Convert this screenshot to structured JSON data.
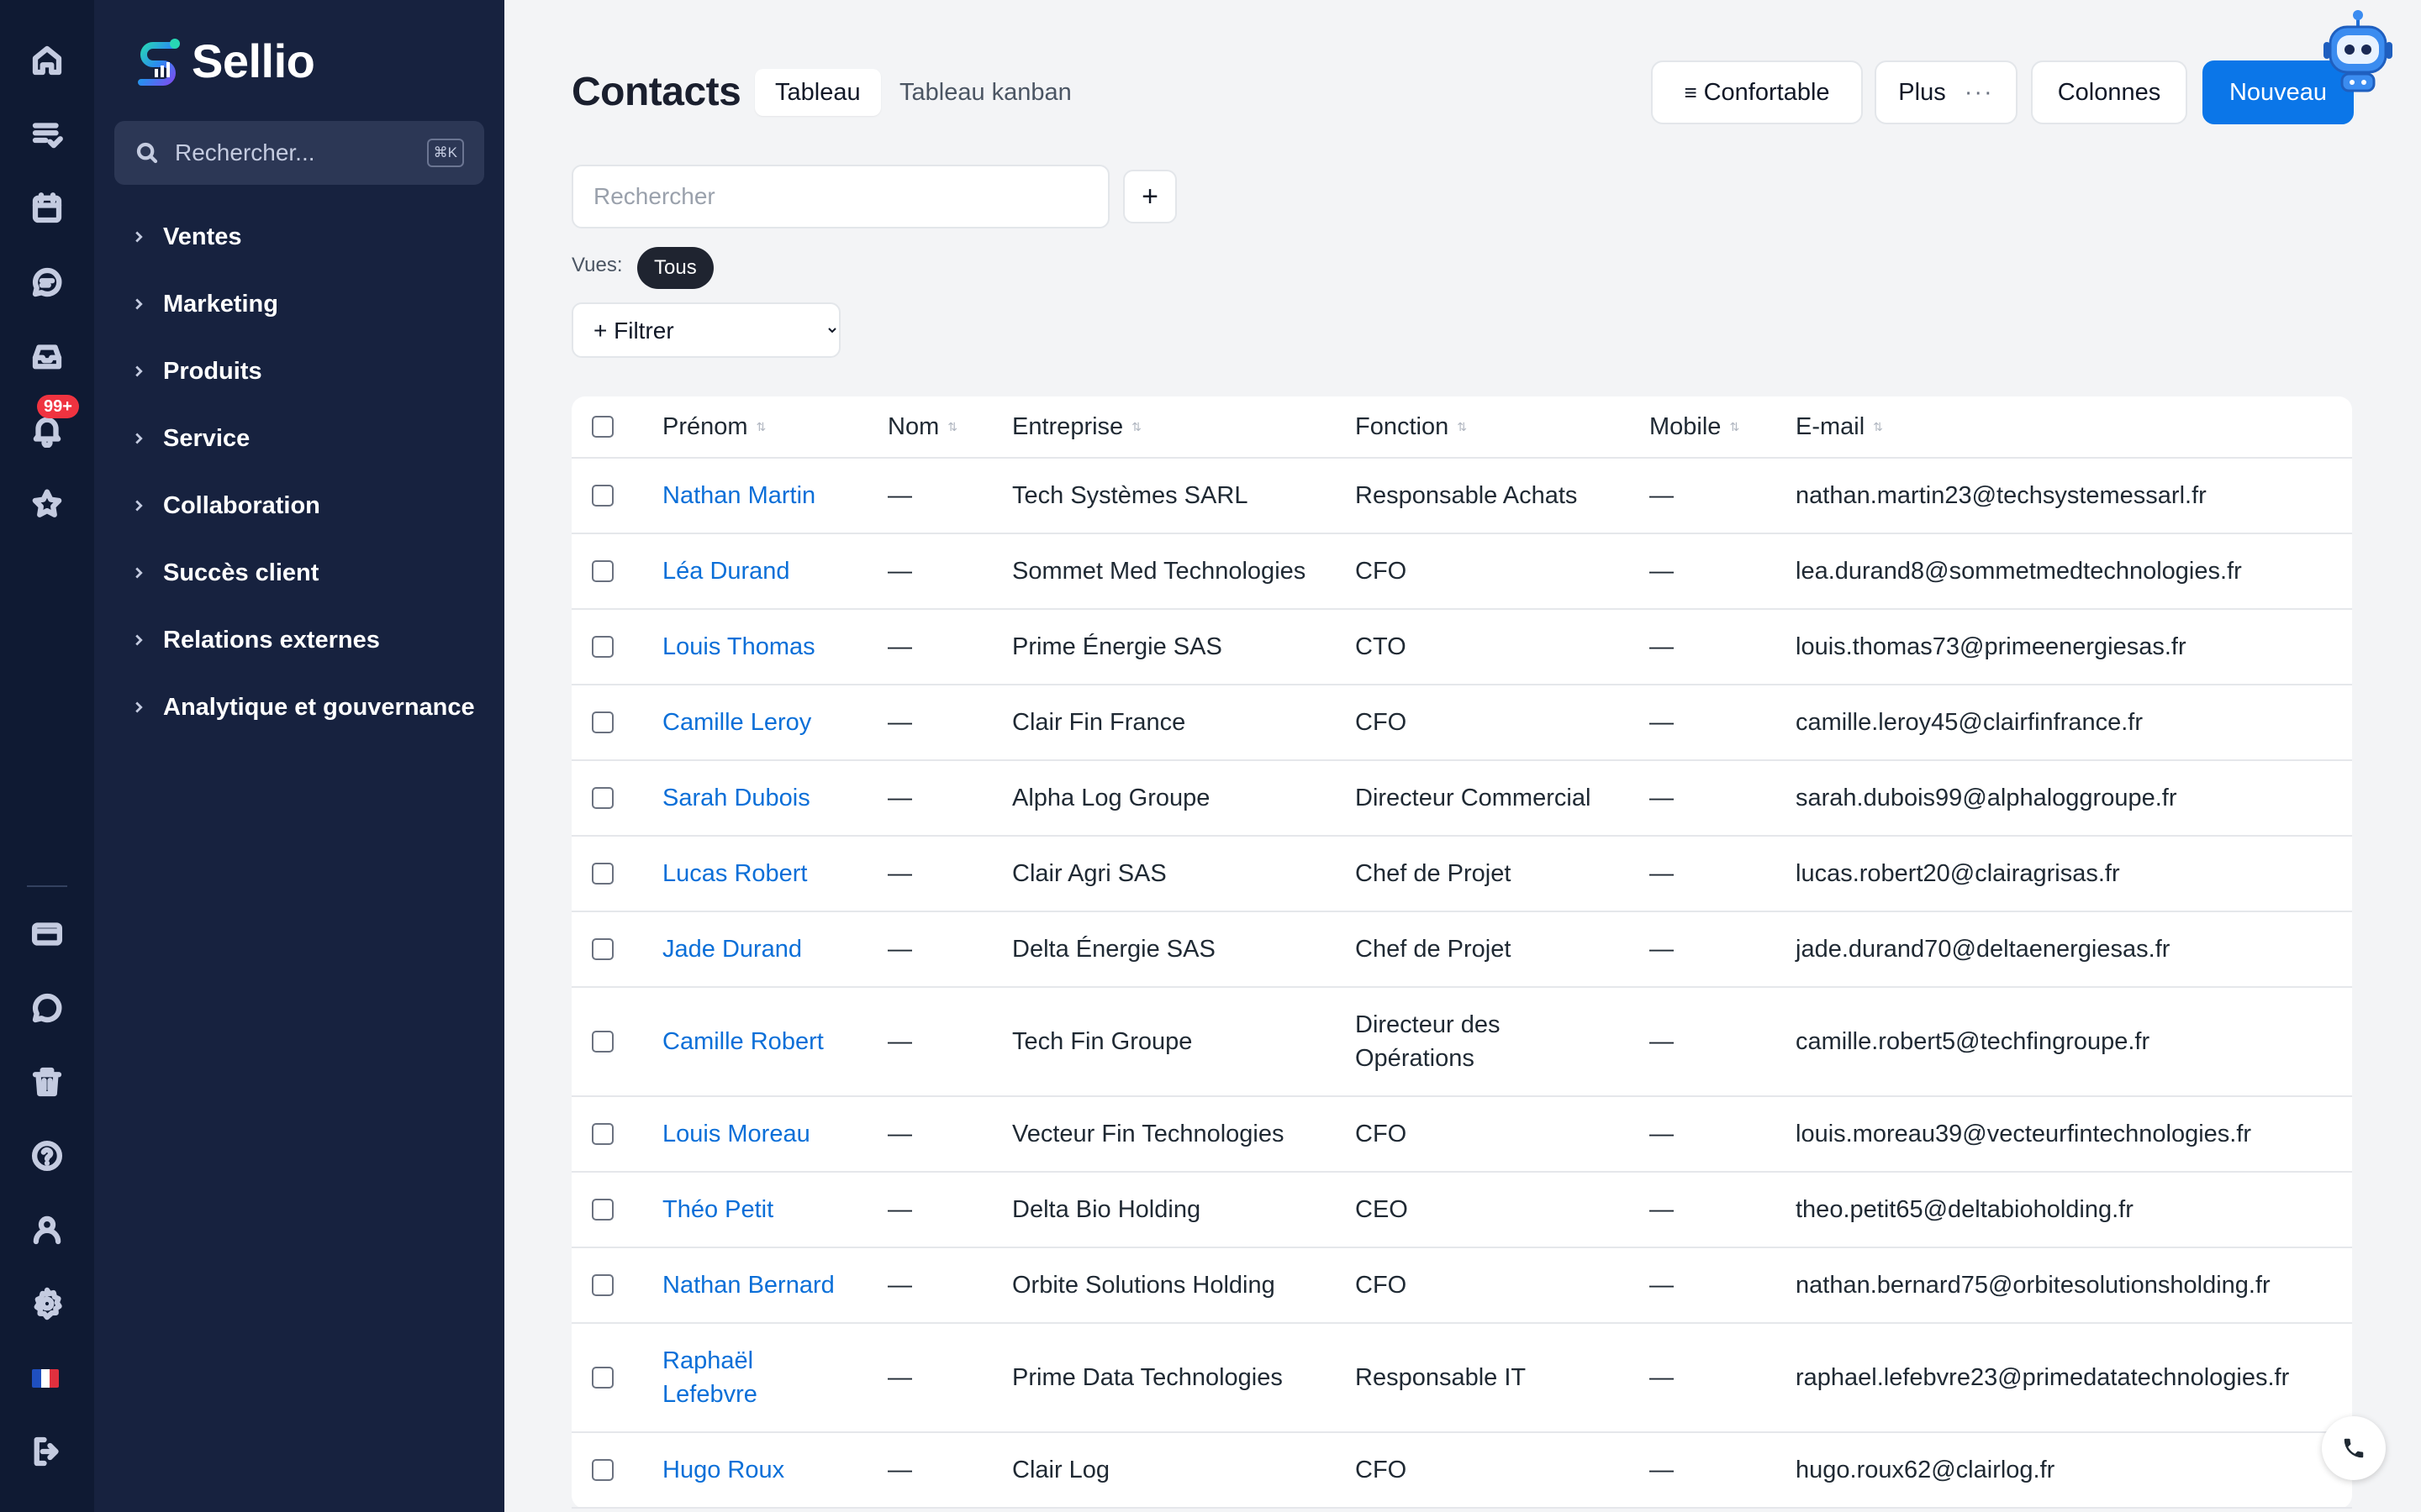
{
  "brand": {
    "name": "Sellio"
  },
  "rail": {
    "notification_count": "99+"
  },
  "sidebar": {
    "search_placeholder": "Rechercher...",
    "shortcut": "⌘K",
    "items": [
      "Ventes",
      "Marketing",
      "Produits",
      "Service",
      "Collaboration",
      "Succès client",
      "Relations externes",
      "Analytique et gouvernance"
    ]
  },
  "header": {
    "title": "Contacts",
    "tabs": [
      "Tableau",
      "Tableau kanban"
    ],
    "active_tab": "Tableau",
    "density_button": "Confortable",
    "more_button": "Plus",
    "columns_button": "Colonnes",
    "new_button": "Nouveau"
  },
  "toolbar": {
    "search_placeholder": "Rechercher",
    "add_symbol": "+",
    "views_label": "Vues:",
    "view_active": "Tous",
    "filter_option": "+ Filtrer"
  },
  "table": {
    "columns": [
      "Prénom",
      "Nom",
      "Entreprise",
      "Fonction",
      "Mobile",
      "E-mail"
    ],
    "rows": [
      [
        "Nathan Martin",
        "—",
        "Tech Systèmes SARL",
        "Responsable Achats",
        "—",
        "nathan.martin23@techsystemessarl.fr"
      ],
      [
        "Léa Durand",
        "—",
        "Sommet Med Technologies",
        "CFO",
        "—",
        "lea.durand8@sommetmedtechnologies.fr"
      ],
      [
        "Louis Thomas",
        "—",
        "Prime Énergie SAS",
        "CTO",
        "—",
        "louis.thomas73@primeenergiesas.fr"
      ],
      [
        "Camille Leroy",
        "—",
        "Clair Fin France",
        "CFO",
        "—",
        "camille.leroy45@clairfinfrance.fr"
      ],
      [
        "Sarah Dubois",
        "—",
        "Alpha Log Groupe",
        "Directeur Commercial",
        "—",
        "sarah.dubois99@alphaloggroupe.fr"
      ],
      [
        "Lucas Robert",
        "—",
        "Clair Agri SAS",
        "Chef de Projet",
        "—",
        "lucas.robert20@clairagrisas.fr"
      ],
      [
        "Jade Durand",
        "—",
        "Delta Énergie SAS",
        "Chef de Projet",
        "—",
        "jade.durand70@deltaenergiesas.fr"
      ],
      [
        "Camille Robert",
        "—",
        "Tech Fin Groupe",
        "Directeur des Opérations",
        "—",
        "camille.robert5@techfingroupe.fr"
      ],
      [
        "Louis Moreau",
        "—",
        "Vecteur Fin Technologies",
        "CFO",
        "—",
        "louis.moreau39@vecteurfintechnologies.fr"
      ],
      [
        "Théo Petit",
        "—",
        "Delta Bio Holding",
        "CEO",
        "—",
        "theo.petit65@deltabioholding.fr"
      ],
      [
        "Nathan Bernard",
        "—",
        "Orbite Solutions Holding",
        "CFO",
        "—",
        "nathan.bernard75@orbitesolutionsholding.fr"
      ],
      [
        "Raphaël Lefebvre",
        "—",
        "Prime Data Technologies",
        "Responsable IT",
        "—",
        "raphael.lefebvre23@primedatatechnologies.fr"
      ],
      [
        "Hugo Roux",
        "—",
        "Clair Log",
        "CFO",
        "—",
        "hugo.roux62@clairlog.fr"
      ]
    ]
  },
  "colors": {
    "rail_bg": "#0f1a33",
    "sidebar_bg": "#17223f",
    "accent": "#0b76e8",
    "link": "#0b6fd8",
    "badge": "#ef3340",
    "page_bg": "#f3f4f6"
  },
  "icons": {
    "rail_top": [
      "home-icon",
      "tasks-icon",
      "calendar-icon",
      "chat-icon",
      "inbox-icon",
      "bell-icon",
      "star-icon"
    ],
    "rail_bottom": [
      "card-icon",
      "message-icon",
      "trash-icon",
      "help-icon",
      "user-icon",
      "settings-icon",
      "flag-fr-icon",
      "logout-icon"
    ]
  }
}
